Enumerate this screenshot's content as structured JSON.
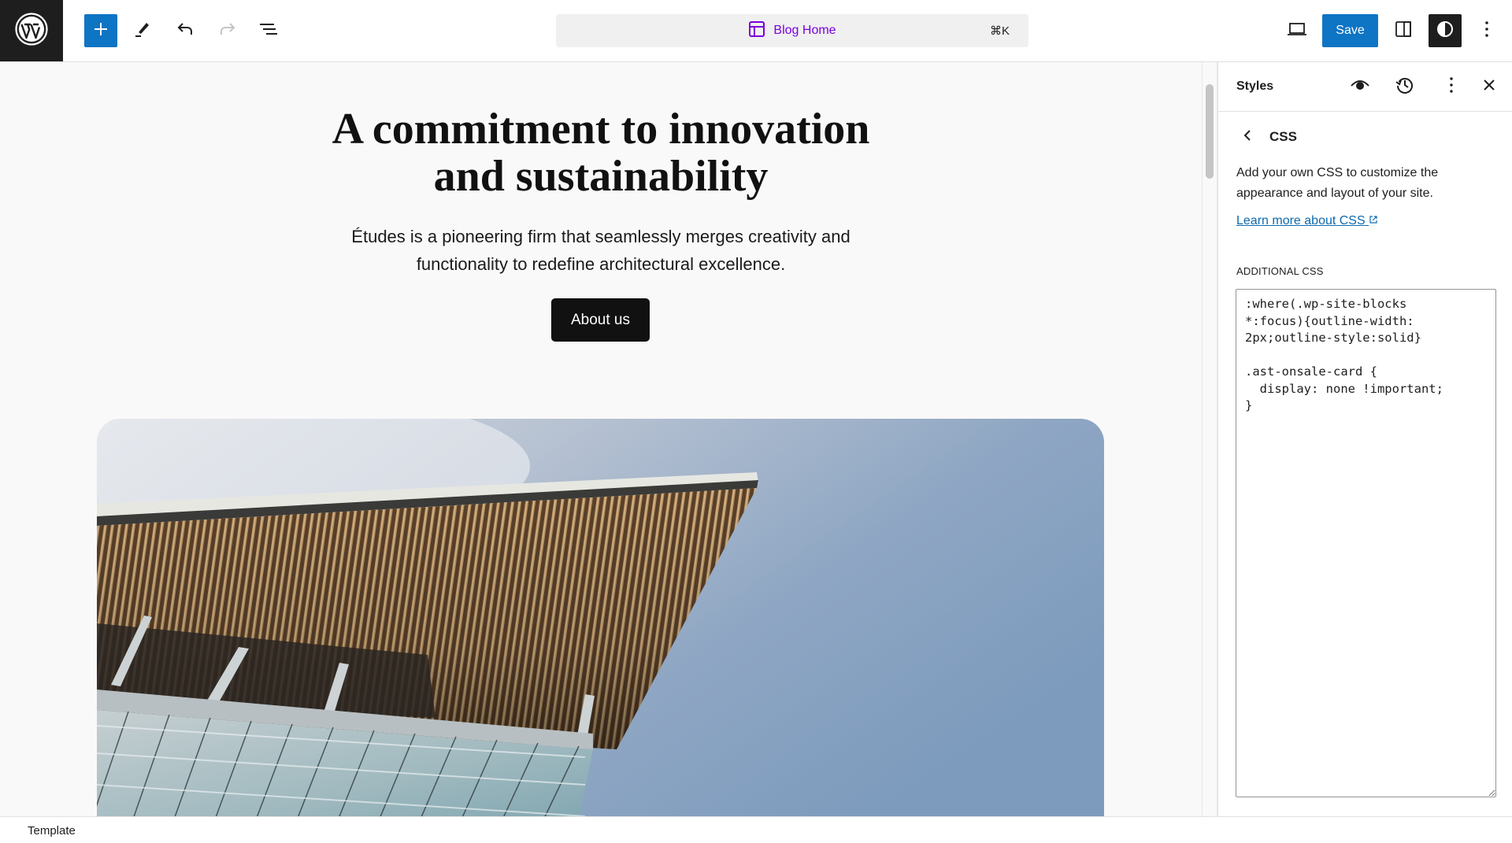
{
  "topbar": {
    "logo_icon": "wordpress-logo-icon",
    "inserter_icon": "plus-icon",
    "tools_icon": "pencil-icon",
    "undo_icon": "undo-icon",
    "redo_icon": "redo-icon",
    "list_view_icon": "list-view-icon",
    "command": {
      "icon": "layout-icon",
      "title": "Blog Home",
      "shortcut": "⌘K"
    },
    "preview_icon": "desktop-icon",
    "save_label": "Save",
    "settings_icon": "sidebar-icon",
    "styles_icon": "contrast-icon",
    "options_icon": "more-vertical-icon",
    "colors": {
      "primary": "#0e74c4",
      "command_text": "#7a00df",
      "dark": "#1e1e1e"
    }
  },
  "canvas": {
    "heading": "A commitment to innovation and sustainability",
    "paragraph": "Études is a pioneering firm that seamlessly merges creativity and functionality to redefine architectural excellence.",
    "button_label": "About us",
    "image_alt": "Building exterior with wooden slat roof against blue sky"
  },
  "panel": {
    "title": "Styles",
    "header_icons": [
      "eye-icon",
      "history-icon",
      "more-vertical-icon",
      "close-icon"
    ],
    "section_title": "CSS",
    "description": "Add your own CSS to customize the appearance and layout of your site.",
    "learn_link": "Learn more about CSS",
    "additional_label": "ADDITIONAL CSS",
    "css_value": ":where(.wp-site-blocks\n*:focus){outline-width:\n2px;outline-style:solid}\n\n.ast-onsale-card {\n  display: none !important;\n}"
  },
  "footer": {
    "breadcrumb": "Template"
  }
}
